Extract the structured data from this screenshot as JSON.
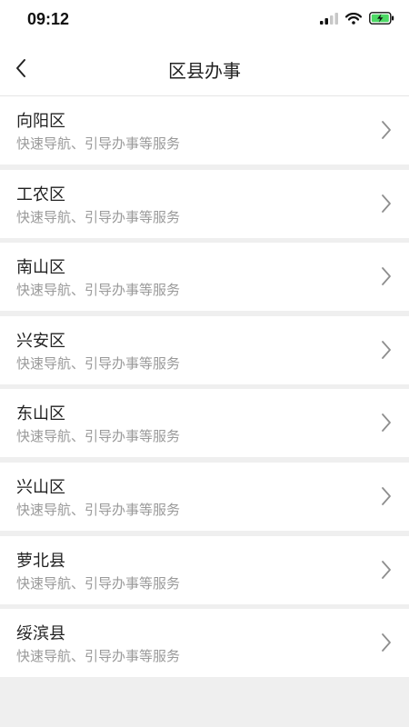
{
  "status_bar": {
    "time": "09:12",
    "icons": [
      "cellular-signal-icon",
      "wifi-icon",
      "battery-charging-icon"
    ]
  },
  "header": {
    "title": "区县办事",
    "back_icon": "chevron-left-icon"
  },
  "districts": [
    {
      "name": "向阳区",
      "subtitle": "快速导航、引导办事等服务"
    },
    {
      "name": "工农区",
      "subtitle": "快速导航、引导办事等服务"
    },
    {
      "name": "南山区",
      "subtitle": "快速导航、引导办事等服务"
    },
    {
      "name": "兴安区",
      "subtitle": "快速导航、引导办事等服务"
    },
    {
      "name": "东山区",
      "subtitle": "快速导航、引导办事等服务"
    },
    {
      "name": "兴山区",
      "subtitle": "快速导航、引导办事等服务"
    },
    {
      "name": "萝北县",
      "subtitle": "快速导航、引导办事等服务"
    },
    {
      "name": "绥滨县",
      "subtitle": "快速导航、引导办事等服务"
    }
  ],
  "colors": {
    "background": "#efefef",
    "card": "#ffffff",
    "title_text": "#222222",
    "subtitle_text": "#9a9a9a",
    "battery_fill": "#4cd964"
  }
}
